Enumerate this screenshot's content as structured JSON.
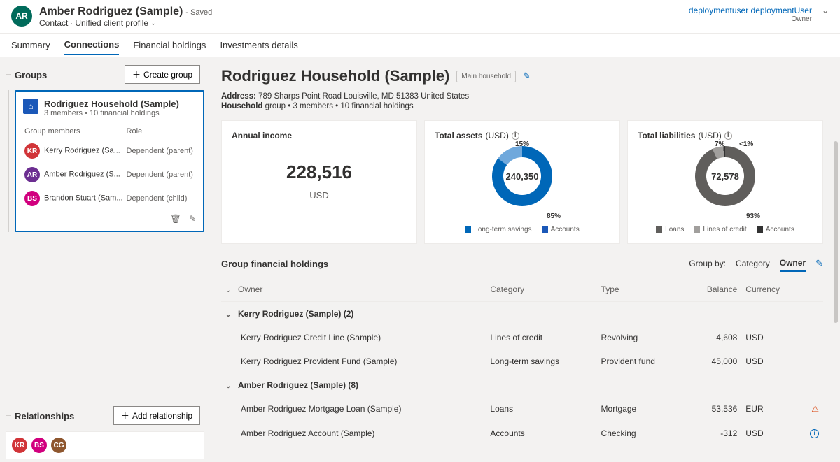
{
  "header": {
    "avatar": "AR",
    "title": "Amber Rodriguez (Sample)",
    "saved": "- Saved",
    "entity": "Contact",
    "form": "Unified client profile",
    "user": "deploymentuser deploymentUser",
    "role": "Owner"
  },
  "tabs": [
    "Summary",
    "Connections",
    "Financial holdings",
    "Investments details"
  ],
  "sidebar": {
    "groups_label": "Groups",
    "create_group": "Create group",
    "card": {
      "name": "Rodriguez Household (Sample)",
      "sub": "3 members • 10 financial holdings",
      "col_members": "Group members",
      "col_role": "Role",
      "members": [
        {
          "initials": "KR",
          "cls": "kr",
          "name": "Kerry Rodriguez (Sa...",
          "role": "Dependent (parent)"
        },
        {
          "initials": "AR",
          "cls": "ar",
          "name": "Amber Rodriguez (S...",
          "role": "Dependent (parent)"
        },
        {
          "initials": "BS",
          "cls": "bs",
          "name": "Brandon Stuart (Sam...",
          "role": "Dependent (child)"
        }
      ]
    },
    "relationships_label": "Relationships",
    "add_relationship": "Add relationship",
    "rel_avatars": [
      {
        "initials": "KR",
        "cls": "kr"
      },
      {
        "initials": "BS",
        "cls": "bs"
      },
      {
        "initials": "CG",
        "cls": "cg"
      }
    ]
  },
  "main": {
    "title": "Rodriguez Household (Sample)",
    "tag": "Main household",
    "address_label": "Address:",
    "address": "789 Sharps Point Road Louisville, MD 51383 United States",
    "meta": "Household group • 3 members • 10 financial holdings",
    "cards": {
      "income": {
        "title": "Annual income",
        "value": "228,516",
        "unit": "USD"
      },
      "assets": {
        "title": "Total assets",
        "unit": "(USD)",
        "center": "240,350",
        "top_pct": "15%",
        "bot_pct": "85%",
        "legend": [
          {
            "c": "#0067b8",
            "t": "Long-term savings"
          },
          {
            "c": "#1b58b8",
            "t": "Accounts"
          }
        ]
      },
      "liab": {
        "title": "Total liabilities",
        "unit": "(USD)",
        "center": "72,578",
        "p1": "7%",
        "p2": "<1%",
        "p3": "93%",
        "legend": [
          {
            "c": "#605e5c",
            "t": "Loans"
          },
          {
            "c": "#a19f9d",
            "t": "Lines of credit"
          },
          {
            "c": "#323232",
            "t": "Accounts"
          }
        ]
      }
    },
    "holdings": {
      "title": "Group financial holdings",
      "groupby_label": "Group by:",
      "groupby": [
        "Category",
        "Owner"
      ],
      "cols": [
        "Owner",
        "Category",
        "Type",
        "Balance",
        "Currency"
      ],
      "groups": [
        {
          "name": "Kerry Rodriguez (Sample) (2)",
          "rows": [
            {
              "owner": "Kerry Rodriguez Credit Line (Sample)",
              "cat": "Lines of credit",
              "type": "Revolving",
              "bal": "4,608",
              "cur": "USD",
              "flag": ""
            },
            {
              "owner": "Kerry Rodriguez Provident Fund (Sample)",
              "cat": "Long-term savings",
              "type": "Provident fund",
              "bal": "45,000",
              "cur": "USD",
              "flag": ""
            }
          ]
        },
        {
          "name": "Amber Rodriguez (Sample) (8)",
          "rows": [
            {
              "owner": "Amber Rodriguez Mortgage Loan (Sample)",
              "cat": "Loans",
              "type": "Mortgage",
              "bal": "53,536",
              "cur": "EUR",
              "flag": "warn"
            },
            {
              "owner": "Amber Rodriguez Account (Sample)",
              "cat": "Accounts",
              "type": "Checking",
              "bal": "-312",
              "cur": "USD",
              "flag": "info"
            }
          ]
        }
      ]
    }
  },
  "chart_data": [
    {
      "type": "pie",
      "title": "Total assets (USD)",
      "total": 240350,
      "series": [
        {
          "name": "Accounts",
          "pct": 85
        },
        {
          "name": "Long-term savings",
          "pct": 15
        }
      ]
    },
    {
      "type": "pie",
      "title": "Total liabilities (USD)",
      "total": 72578,
      "series": [
        {
          "name": "Loans",
          "pct": 93
        },
        {
          "name": "Lines of credit",
          "pct": 7
        },
        {
          "name": "Accounts",
          "pct": 0.5
        }
      ]
    }
  ]
}
